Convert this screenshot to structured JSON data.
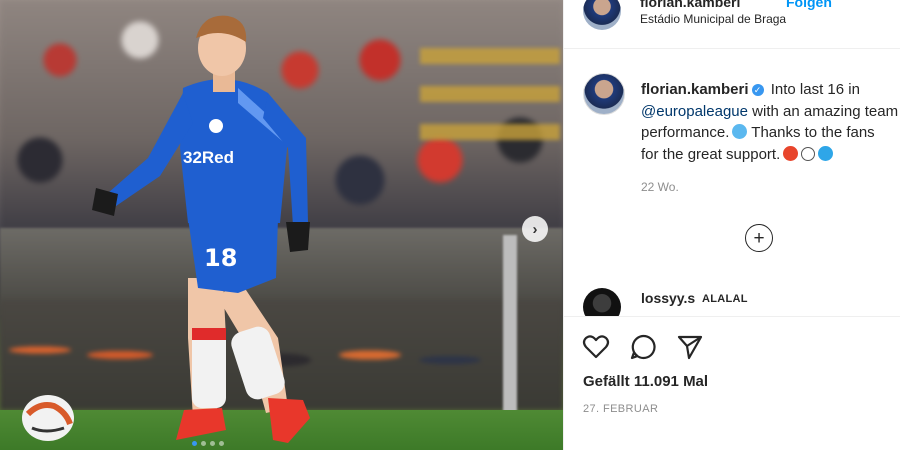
{
  "post": {
    "header": {
      "username": "florian.kamberi",
      "follow_label": "Folgen",
      "location": "Estádio Municipal de Braga"
    },
    "caption": {
      "username": "florian.kamberi",
      "lines": [
        "Into last 16 in",
        "with an amazing team",
        "performance.",
        "Thanks to the fans",
        "for the great support."
      ],
      "mention": "@europaleague",
      "time": "22 Wo."
    },
    "comments": [
      {
        "username": "lossyy.s",
        "text": "ALALAL"
      }
    ],
    "likes": "Gefällt 11.091 Mal",
    "date": "27. FEBRUAR",
    "carousel": {
      "slides": 4,
      "active_index": 0
    }
  },
  "player_shirt": {
    "sponsor": "32Red",
    "number": "18"
  },
  "colors": {
    "accent": "#3897f0",
    "jersey": "#1f5fd0"
  },
  "icons": {
    "verified": "verified-badge-icon",
    "like": "heart-icon",
    "comment": "comment-icon",
    "share": "share-icon",
    "more_comments": "plus-circle-icon",
    "next": "chevron-right-icon"
  }
}
